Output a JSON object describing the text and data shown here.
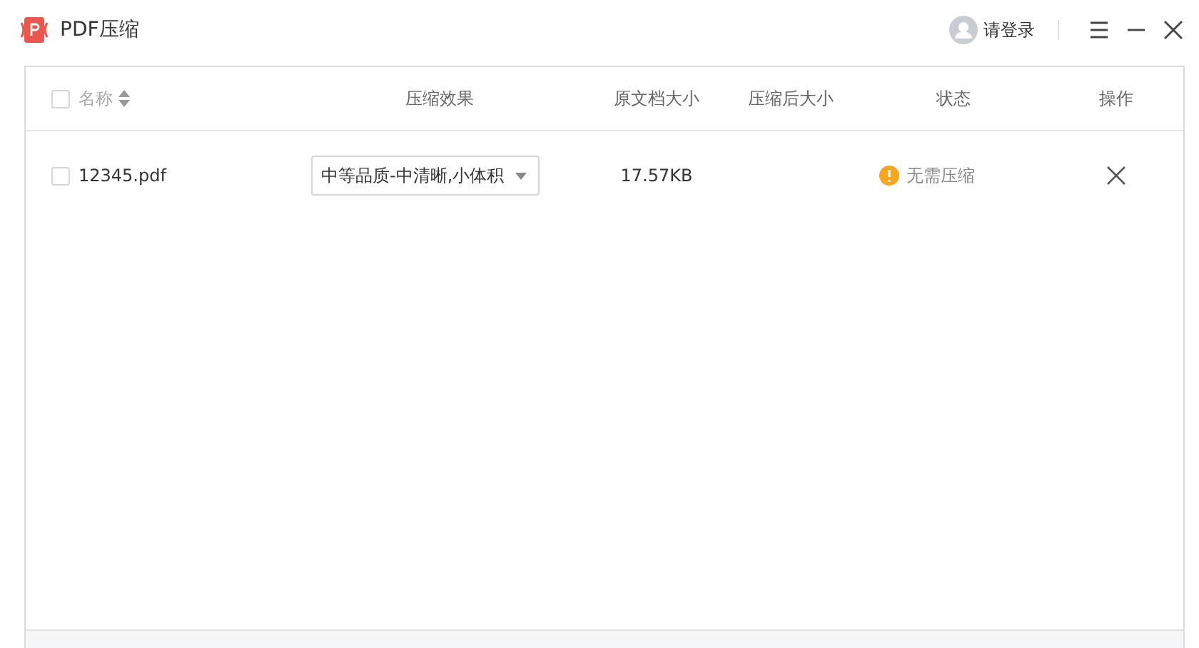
{
  "window": {
    "title": "PDF压缩",
    "login": "请登录"
  },
  "table": {
    "select_all": {
      "checked": false
    },
    "columns": [
      "名称",
      "压缩效果",
      "原文档大小",
      "压缩后大小",
      "状态",
      "操作"
    ],
    "rows": [
      {
        "checked": false,
        "name": "12345.pdf",
        "effect": "中等品质-中清晰,小体积",
        "original_size": "17.57KB",
        "status": {
          "kind": "warning",
          "text": "无需压缩"
        }
      }
    ]
  }
}
